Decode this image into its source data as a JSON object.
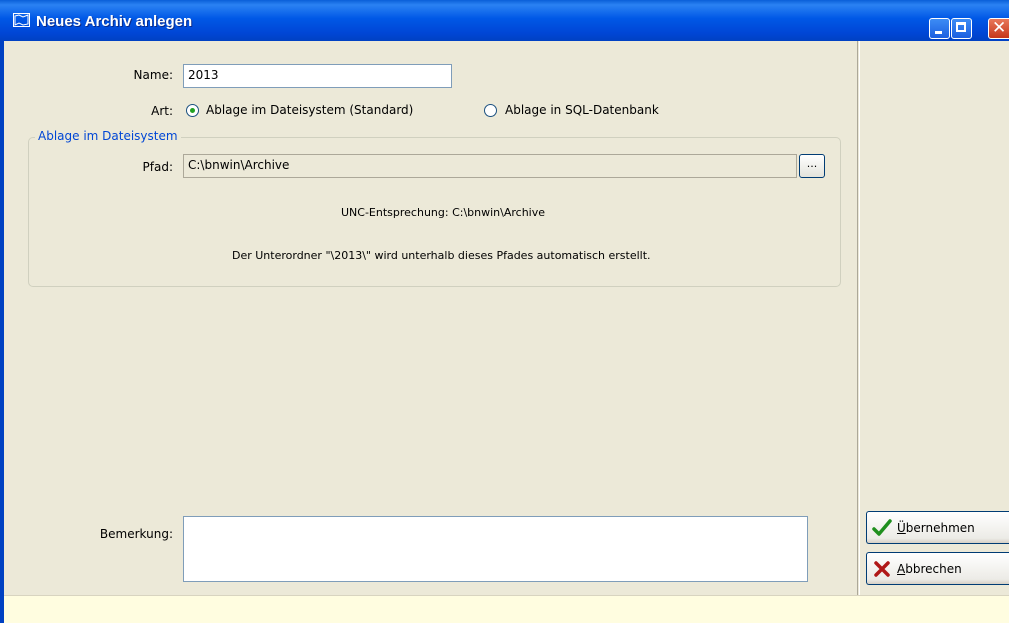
{
  "window": {
    "title": "Neues Archiv anlegen",
    "title_icon": "archive-map-icon"
  },
  "form": {
    "name_label": "Name:",
    "name_value": "2013",
    "art_label": "Art:",
    "option_filesystem": "Ablage im Dateisystem (Standard)",
    "option_sql": "Ablage in SQL-Datenbank",
    "selected_option": "filesystem",
    "group_title": "Ablage im Dateisystem",
    "path_label": "Pfad:",
    "path_value": "C:\\bnwin\\Archive",
    "browse_label": "...",
    "unc_text": "UNC-Entsprechung: C:\\bnwin\\Archive",
    "subfolder_text": "Der Unterordner \"\\2013\\\" wird unterhalb dieses Pfades automatisch erstellt.",
    "remark_label": "Bemerkung:",
    "remark_value": ""
  },
  "buttons": {
    "apply_accel": "Ü",
    "apply_rest": "bernehmen",
    "cancel_accel": "A",
    "cancel_rest": "bbrechen"
  },
  "colors": {
    "titlebar": "#0058e6",
    "window_bg": "#ece9d8",
    "group_title": "#0046d5",
    "statusbar": "#fffde0"
  }
}
